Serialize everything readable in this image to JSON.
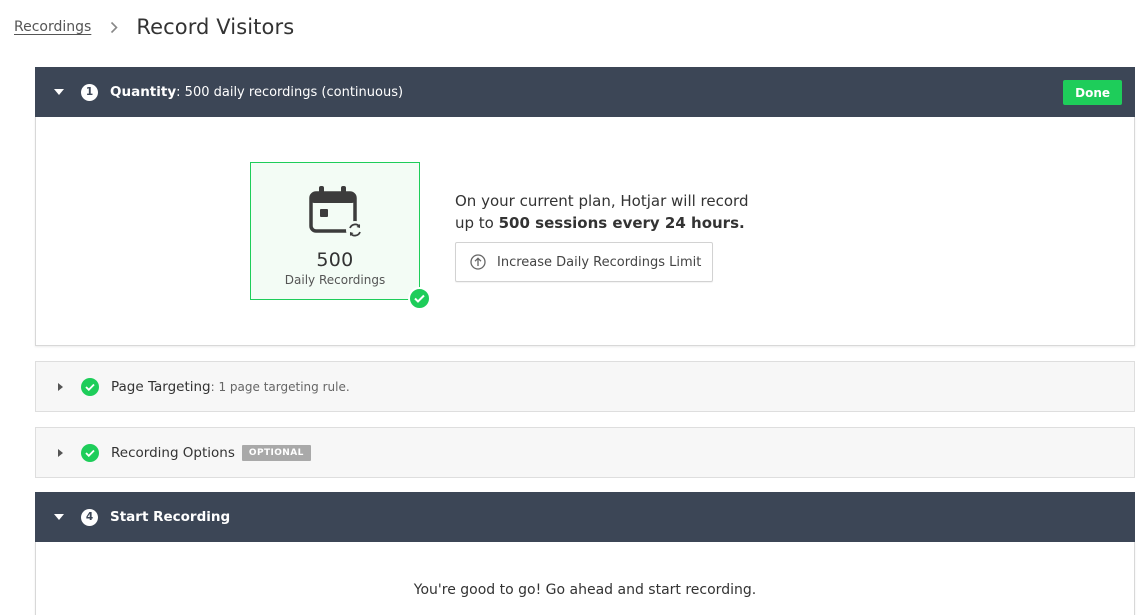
{
  "breadcrumb": {
    "parent": "Recordings",
    "current": "Record Visitors"
  },
  "steps": {
    "quantity": {
      "number": "1",
      "title": "Quantity",
      "detail": ": 500 daily recordings (continuous)",
      "done_label": "Done",
      "card_value": "500",
      "card_label": "Daily Recordings",
      "plan_line1": "On your current plan, Hotjar will record",
      "plan_line2_prefix": "up to ",
      "plan_line2_bold": "500 sessions every 24 hours.",
      "increase_label": "Increase Daily Recordings Limit"
    },
    "page_targeting": {
      "title": "Page Targeting",
      "detail": ": 1 page targeting rule."
    },
    "recording_options": {
      "title": "Recording Options",
      "badge": "OPTIONAL"
    },
    "start_recording": {
      "number": "4",
      "title": "Start Recording",
      "message": "You're good to go! Go ahead and start recording."
    }
  },
  "colors": {
    "header_bg": "#3c4656",
    "accent_green": "#1ecd5a",
    "card_bg": "#f3fcf5"
  },
  "icons": {
    "breadcrumb_separator": "chevron-right-icon",
    "collapse": "caret-down-icon",
    "expand": "caret-right-icon",
    "complete": "check-circle-icon",
    "calendar": "calendar-refresh-icon",
    "upgrade": "arrow-up-circle-icon"
  }
}
